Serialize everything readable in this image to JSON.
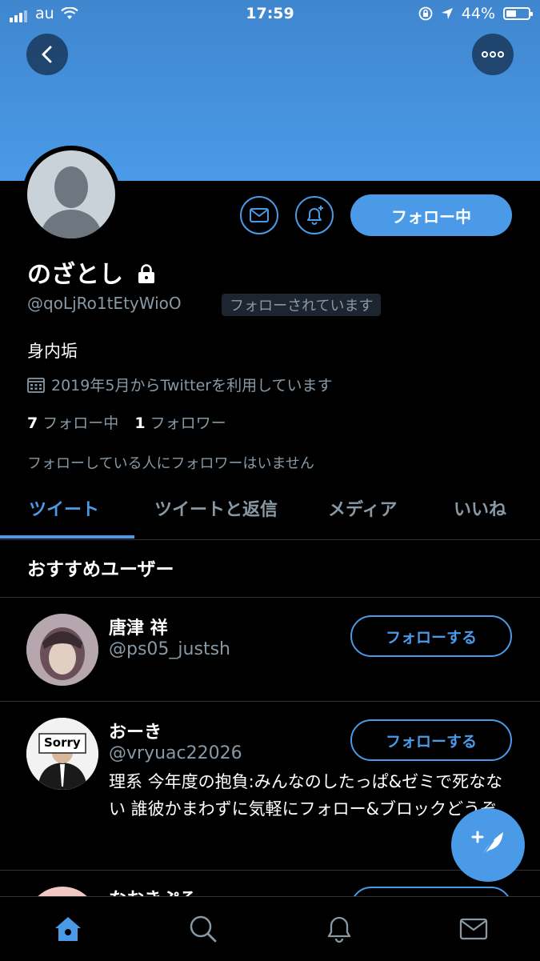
{
  "status_bar": {
    "carrier": "au",
    "time": "17:59",
    "battery": "44%"
  },
  "profile": {
    "name": "のざとし",
    "handle": "@qoLjRo1tEtyWioO",
    "follows_you": "フォローされています",
    "bio": "身内垢",
    "joined": "2019年5月からTwitterを利用しています",
    "following_count": "7",
    "following_label": "フォロー中",
    "followers_count": "1",
    "followers_label": "フォロワー",
    "follower_note": "フォローしている人にフォロワーはいません",
    "follow_state_label": "フォロー中"
  },
  "tabs": [
    "ツイート",
    "ツイートと返信",
    "メディア",
    "いいね"
  ],
  "recommended": {
    "title": "おすすめユーザー",
    "users": [
      {
        "name": "唐津 祥",
        "handle": "@ps05_justsh",
        "bio": "",
        "button": "フォローする"
      },
      {
        "name": "おーき",
        "handle": "@vryuac22026",
        "bio": "理系 今年度の抱負:みんなのしたっぱ&ゼミで死なない 誰彼かまわずに気軽にフォロー&ブロックどうぞ",
        "button": "フォローする"
      },
      {
        "name": "なおきぷる",
        "handle": "",
        "bio": "",
        "button": ""
      }
    ],
    "avatar_text": "Sorry"
  },
  "colors": {
    "accent": "#4a9ae8",
    "banner": "#4a9ae8",
    "muted": "#8899a6",
    "background": "#000000"
  }
}
